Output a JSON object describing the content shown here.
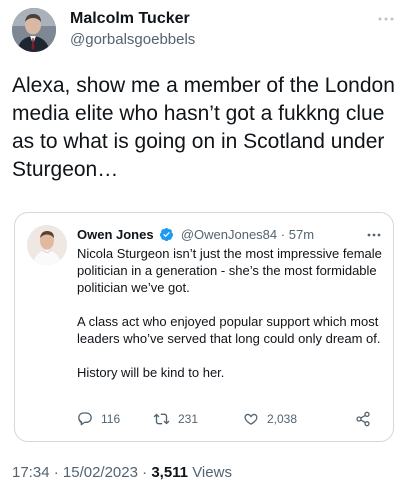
{
  "author": {
    "name": "Malcolm Tucker",
    "handle": "@gorbalsgoebbels"
  },
  "tweet": {
    "text": "Alexa, show me a member of the London media elite who hasn’t got a fukkng clue as to what is going on in Scotland under Sturgeon…"
  },
  "quoted_tweet": {
    "name": "Owen Jones",
    "handle": "@OwenJones84",
    "separator": "·",
    "time": "57m",
    "paragraphs": [
      "Nicola Sturgeon isn’t just the most impressive female politician in a generation - she’s the most formidable politician we’ve got.",
      "A class act who enjoyed popular support which most leaders who’ve served that long could only dream of.",
      "History will be kind to her."
    ],
    "counts": {
      "replies": "116",
      "retweets": "231",
      "likes": "2,038"
    }
  },
  "meta": {
    "time": "17:34",
    "sep1": "·",
    "date": "15/02/2023",
    "sep2": "·",
    "views_count": "3,511",
    "views_label": "Views"
  },
  "colors": {
    "text_primary": "#0f1419",
    "text_secondary": "#536471",
    "border": "#cfd9de",
    "verified_blue": "#1d9bf0"
  },
  "icons": {
    "more": "more-horizontal-icon",
    "verified": "verified-badge-icon",
    "reply": "reply-icon",
    "retweet": "retweet-icon",
    "like": "heart-icon",
    "share": "share-icon"
  }
}
